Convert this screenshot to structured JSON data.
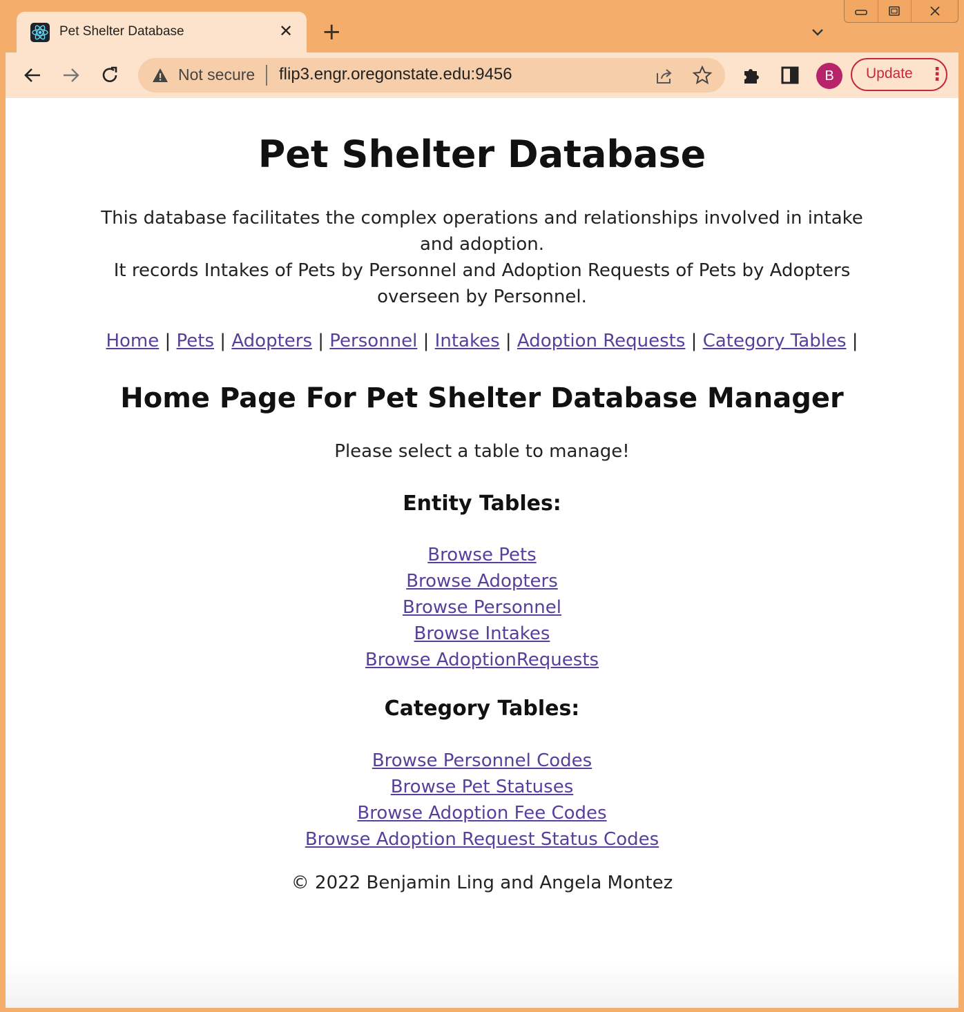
{
  "browser": {
    "tab": {
      "title": "Pet Shelter Database",
      "close_glyph": "✕"
    },
    "new_tab_glyph": "+",
    "omnibox": {
      "security_label": "Not secure",
      "url": "flip3.engr.oregonstate.edu:9456"
    },
    "profile_initial": "B",
    "update_label": "Update",
    "accent_color": "#f4ad6a"
  },
  "page": {
    "title": "Pet Shelter Database",
    "description": [
      "This database facilitates the complex operations and relationships involved in intake and adoption.",
      "It records Intakes of Pets by Personnel and Adoption Requests of Pets by Adopters overseen by Personnel."
    ],
    "nav": [
      {
        "label": "Home"
      },
      {
        "label": "Pets"
      },
      {
        "label": "Adopters"
      },
      {
        "label": "Personnel"
      },
      {
        "label": "Intakes"
      },
      {
        "label": "Adoption Requests"
      },
      {
        "label": "Category Tables"
      }
    ],
    "nav_separator": "|",
    "heading": "Home Page For Pet Shelter Database Manager",
    "prompt": "Please select a table to manage!",
    "entity_tables": {
      "heading": "Entity Tables:",
      "links": [
        "Browse Pets",
        "Browse Adopters",
        "Browse Personnel",
        "Browse Intakes",
        "Browse AdoptionRequests"
      ]
    },
    "category_tables": {
      "heading": "Category Tables:",
      "links": [
        "Browse Personnel Codes",
        "Browse Pet Statuses",
        "Browse Adoption Fee Codes",
        "Browse Adoption Request Status Codes"
      ]
    },
    "footer": "© 2022 Benjamin Ling and Angela Montez",
    "link_color": "#57409b"
  }
}
